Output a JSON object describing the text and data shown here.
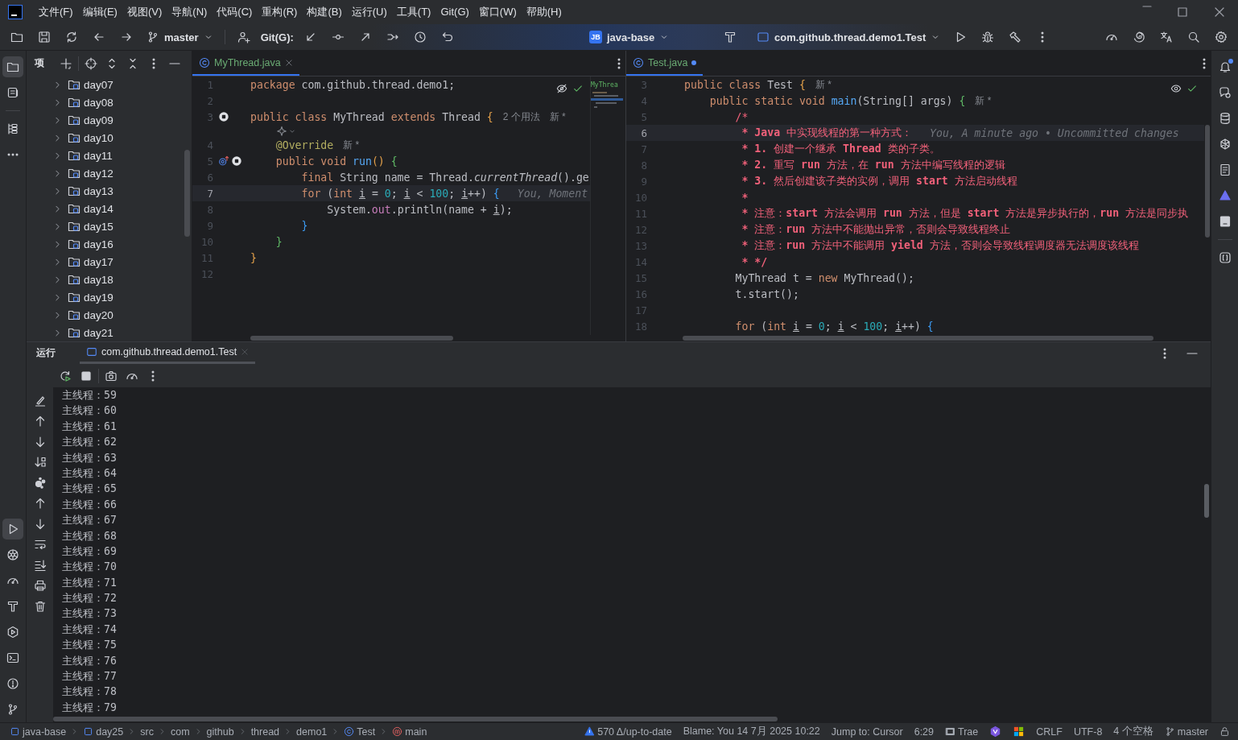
{
  "title_bar": {
    "menus": [
      "文件(F)",
      "编辑(E)",
      "视图(V)",
      "导航(N)",
      "代码(C)",
      "重构(R)",
      "构建(B)",
      "运行(U)",
      "工具(T)",
      "Git(G)",
      "窗口(W)",
      "帮助(H)"
    ]
  },
  "toolbar": {
    "branch": "master",
    "git_label": "Git(G):",
    "project_badge": "JB",
    "project": "java-base",
    "run_config": "com.github.thread.demo1.Test"
  },
  "activity_bar": {
    "top": [
      {
        "kind": "project",
        "selected": true
      },
      {
        "kind": "commit",
        "selected": false
      },
      {
        "kind": "structure",
        "selected": false
      },
      {
        "kind": "more",
        "selected": false
      }
    ],
    "bottom": [
      {
        "kind": "run",
        "selected": true
      },
      {
        "kind": "services",
        "selected": false
      },
      {
        "kind": "profiler",
        "selected": false
      },
      {
        "kind": "build",
        "selected": false
      },
      {
        "kind": "endpoints",
        "selected": false
      },
      {
        "kind": "terminal",
        "selected": false
      },
      {
        "kind": "problems",
        "selected": false
      },
      {
        "kind": "git",
        "selected": false
      }
    ]
  },
  "project_panel": {
    "title": "项",
    "items": [
      {
        "label": "day07",
        "expanded": false
      },
      {
        "label": "day08",
        "expanded": false
      },
      {
        "label": "day09",
        "expanded": false
      },
      {
        "label": "day10",
        "expanded": false
      },
      {
        "label": "day11",
        "expanded": false
      },
      {
        "label": "day12",
        "expanded": false
      },
      {
        "label": "day13",
        "expanded": false
      },
      {
        "label": "day14",
        "expanded": false
      },
      {
        "label": "day15",
        "expanded": false
      },
      {
        "label": "day16",
        "expanded": false
      },
      {
        "label": "day17",
        "expanded": false
      },
      {
        "label": "day18",
        "expanded": false
      },
      {
        "label": "day19",
        "expanded": false
      },
      {
        "label": "day20",
        "expanded": false
      },
      {
        "label": "day21",
        "expanded": false
      }
    ]
  },
  "editors": [
    {
      "tabs": [
        {
          "label": "MyThread.java",
          "selected": true,
          "modified": false
        }
      ],
      "minimap_label": "MyThrea",
      "lines": [
        {
          "kind": "code",
          "number": "1",
          "current": false,
          "t": [
            {
              "kind": "kw",
              "text": "package "
            },
            {
              "kind": "plain",
              "text": "com.github.thread.demo1;"
            }
          ]
        },
        {
          "kind": "code",
          "number": "2",
          "current": false
        },
        {
          "kind": "code",
          "number": "3",
          "current": false,
          "gutter": [
            {
              "kind": "stop"
            }
          ],
          "t": [
            {
              "kind": "kw",
              "text": "public class "
            },
            {
              "kind": "plain",
              "text": "MyThread "
            },
            {
              "kind": "kw",
              "text": "extends "
            },
            {
              "kind": "plain",
              "text": "Thread "
            },
            {
              "kind": "br1",
              "text": "{"
            },
            {
              "kind": "hint",
              "text": "2 个用法"
            },
            {
              "kind": "hint",
              "text": "新 *"
            }
          ]
        },
        {
          "kind": "inlay",
          "current": false
        },
        {
          "kind": "code",
          "number": "4",
          "current": false,
          "t": [
            {
              "kind": "annot",
              "text": "    @Override"
            },
            {
              "kind": "hint",
              "text": "新 *"
            }
          ]
        },
        {
          "kind": "code",
          "number": "5",
          "current": false,
          "gutter": [
            {
              "kind": "override"
            },
            {
              "kind": "stop"
            }
          ],
          "t": [
            {
              "kind": "kw",
              "text": "    public void "
            },
            {
              "kind": "fn",
              "text": "run"
            },
            {
              "kind": "br1",
              "text": "()"
            },
            {
              "kind": "br2",
              "text": " {"
            }
          ]
        },
        {
          "kind": "code",
          "number": "6",
          "current": false,
          "t": [
            {
              "kind": "kw",
              "text": "        final "
            },
            {
              "kind": "plain",
              "text": "String name = Thread."
            },
            {
              "kind": "italic",
              "text": "currentThread"
            },
            {
              "kind": "plain",
              "text": "().ge"
            }
          ]
        },
        {
          "kind": "code",
          "number": "7",
          "current": true,
          "t": [
            {
              "kind": "kw",
              "text": "        for "
            },
            {
              "kind": "plain",
              "text": "("
            },
            {
              "kind": "kw",
              "text": "int "
            },
            {
              "kind": "var",
              "text": "i"
            },
            {
              "kind": "plain",
              "text": " = "
            },
            {
              "kind": "num",
              "text": "0"
            },
            {
              "kind": "plain",
              "text": "; "
            },
            {
              "kind": "var",
              "text": "i"
            },
            {
              "kind": "plain",
              "text": " < "
            },
            {
              "kind": "num",
              "text": "100"
            },
            {
              "kind": "plain",
              "text": "; "
            },
            {
              "kind": "var",
              "text": "i"
            },
            {
              "kind": "plain",
              "text": "++) "
            },
            {
              "kind": "br3",
              "text": "{"
            },
            {
              "kind": "blame",
              "text": "You, Moment"
            }
          ]
        },
        {
          "kind": "code",
          "number": "8",
          "current": false,
          "t": [
            {
              "kind": "plain",
              "text": "            System."
            },
            {
              "kind": "field",
              "text": "out"
            },
            {
              "kind": "plain",
              "text": ".println(name + "
            },
            {
              "kind": "var",
              "text": "i"
            },
            {
              "kind": "plain",
              "text": ");"
            }
          ]
        },
        {
          "kind": "code",
          "number": "9",
          "current": false,
          "t": [
            {
              "kind": "br3",
              "text": "        }"
            }
          ]
        },
        {
          "kind": "code",
          "number": "10",
          "current": false,
          "t": [
            {
              "kind": "br2",
              "text": "    }"
            }
          ]
        },
        {
          "kind": "code",
          "number": "11",
          "current": false,
          "t": [
            {
              "kind": "br1",
              "text": "}"
            }
          ]
        },
        {
          "kind": "code",
          "number": "12",
          "current": false
        }
      ]
    },
    {
      "tabs": [
        {
          "label": "Test.java",
          "selected": true,
          "modified": true
        }
      ],
      "lines": [
        {
          "kind": "code",
          "number": "3",
          "current": false,
          "t": [
            {
              "kind": "kw",
              "text": "public class "
            },
            {
              "kind": "plain",
              "text": "Test "
            },
            {
              "kind": "br1",
              "text": "{"
            },
            {
              "kind": "hint",
              "text": "新 *"
            }
          ]
        },
        {
          "kind": "code",
          "number": "4",
          "current": false,
          "t": [
            {
              "kind": "kw",
              "text": "    public static void "
            },
            {
              "kind": "fn",
              "text": "main"
            },
            {
              "kind": "plain",
              "text": "(String[] args) "
            },
            {
              "kind": "br2",
              "text": "{"
            },
            {
              "kind": "hint",
              "text": "新 *"
            }
          ]
        },
        {
          "kind": "code",
          "number": "5",
          "current": false,
          "t": [
            {
              "kind": "doc",
              "text": "        /*"
            }
          ]
        },
        {
          "kind": "code",
          "number": "6",
          "current": true,
          "t": [
            {
              "kind": "docb",
              "text": "         * Java "
            },
            {
              "kind": "doc",
              "text": "中实现线程的第一种方式："
            },
            {
              "kind": "blame",
              "text": "You, A minute ago • Uncommitted changes"
            }
          ]
        },
        {
          "kind": "code",
          "number": "7",
          "current": false,
          "t": [
            {
              "kind": "docb",
              "text": "         * 1. "
            },
            {
              "kind": "doc",
              "text": "创建一个继承 "
            },
            {
              "kind": "docb",
              "text": "Thread "
            },
            {
              "kind": "doc",
              "text": "类的子类。"
            }
          ]
        },
        {
          "kind": "code",
          "number": "8",
          "current": false,
          "t": [
            {
              "kind": "docb",
              "text": "         * 2. "
            },
            {
              "kind": "doc",
              "text": "重写 "
            },
            {
              "kind": "docb",
              "text": "run "
            },
            {
              "kind": "doc",
              "text": "方法，在 "
            },
            {
              "kind": "docb",
              "text": "run "
            },
            {
              "kind": "doc",
              "text": "方法中编写线程的逻辑"
            }
          ]
        },
        {
          "kind": "code",
          "number": "9",
          "current": false,
          "t": [
            {
              "kind": "docb",
              "text": "         * 3. "
            },
            {
              "kind": "doc",
              "text": "然后创建该子类的实例，调用 "
            },
            {
              "kind": "docb",
              "text": "start "
            },
            {
              "kind": "doc",
              "text": "方法启动线程"
            }
          ]
        },
        {
          "kind": "code",
          "number": "10",
          "current": false,
          "t": [
            {
              "kind": "docb",
              "text": "         *"
            }
          ]
        },
        {
          "kind": "code",
          "number": "11",
          "current": false,
          "t": [
            {
              "kind": "docb",
              "text": "         * "
            },
            {
              "kind": "doc",
              "text": "注意："
            },
            {
              "kind": "docb",
              "text": "start "
            },
            {
              "kind": "doc",
              "text": "方法会调用 "
            },
            {
              "kind": "docb",
              "text": "run "
            },
            {
              "kind": "doc",
              "text": "方法，但是 "
            },
            {
              "kind": "docb",
              "text": "start "
            },
            {
              "kind": "doc",
              "text": "方法是异步执行的，"
            },
            {
              "kind": "docb",
              "text": "run "
            },
            {
              "kind": "doc",
              "text": "方法是同步执"
            }
          ]
        },
        {
          "kind": "code",
          "number": "12",
          "current": false,
          "t": [
            {
              "kind": "docb",
              "text": "         * "
            },
            {
              "kind": "doc",
              "text": "注意："
            },
            {
              "kind": "docb",
              "text": "run "
            },
            {
              "kind": "doc",
              "text": "方法中不能抛出异常，否则会导致线程终止"
            }
          ]
        },
        {
          "kind": "code",
          "number": "13",
          "current": false,
          "t": [
            {
              "kind": "docb",
              "text": "         * "
            },
            {
              "kind": "doc",
              "text": "注意："
            },
            {
              "kind": "docb",
              "text": "run "
            },
            {
              "kind": "doc",
              "text": "方法中不能调用 "
            },
            {
              "kind": "docb",
              "text": "yield "
            },
            {
              "kind": "doc",
              "text": "方法，否则会导致线程调度器无法调度该线程"
            }
          ]
        },
        {
          "kind": "code",
          "number": "14",
          "current": false,
          "t": [
            {
              "kind": "docb",
              "text": "         * */"
            }
          ]
        },
        {
          "kind": "code",
          "number": "15",
          "current": false,
          "t": [
            {
              "kind": "plain",
              "text": "        MyThread t = "
            },
            {
              "kind": "kw",
              "text": "new "
            },
            {
              "kind": "plain",
              "text": "MyThread();"
            }
          ]
        },
        {
          "kind": "code",
          "number": "16",
          "current": false,
          "t": [
            {
              "kind": "plain",
              "text": "        t.start();"
            }
          ]
        },
        {
          "kind": "code",
          "number": "17",
          "current": false
        },
        {
          "kind": "code",
          "number": "18",
          "current": false,
          "t": [
            {
              "kind": "kw",
              "text": "        for "
            },
            {
              "kind": "plain",
              "text": "("
            },
            {
              "kind": "kw",
              "text": "int "
            },
            {
              "kind": "var",
              "text": "i"
            },
            {
              "kind": "plain",
              "text": " = "
            },
            {
              "kind": "num",
              "text": "0"
            },
            {
              "kind": "plain",
              "text": "; "
            },
            {
              "kind": "var",
              "text": "i"
            },
            {
              "kind": "plain",
              "text": " < "
            },
            {
              "kind": "num",
              "text": "100"
            },
            {
              "kind": "plain",
              "text": "; "
            },
            {
              "kind": "var",
              "text": "i"
            },
            {
              "kind": "plain",
              "text": "++) "
            },
            {
              "kind": "br3",
              "text": "{"
            }
          ]
        }
      ]
    }
  ],
  "run_panel": {
    "title": "运行",
    "tabs": [
      {
        "label": "com.github.thread.demo1.Test",
        "selected": true
      }
    ],
    "output": [
      "主线程：59",
      "主线程：60",
      "主线程：61",
      "主线程：62",
      "主线程：63",
      "主线程：64",
      "主线程：65",
      "主线程：66",
      "主线程：67",
      "主线程：68",
      "主线程：69",
      "主线程：70",
      "主线程：71",
      "主线程：72",
      "主线程：73",
      "主线程：74",
      "主线程：75",
      "主线程：76",
      "主线程：77",
      "主线程：78",
      "主线程：79"
    ]
  },
  "status_bar": {
    "breadcrumbs": [
      {
        "label": "java-base",
        "kind": "module"
      },
      {
        "label": "day25",
        "kind": "module"
      },
      {
        "label": "src",
        "kind": "package"
      },
      {
        "label": "com",
        "kind": "package"
      },
      {
        "label": "github",
        "kind": "package"
      },
      {
        "label": "thread",
        "kind": "package"
      },
      {
        "label": "demo1",
        "kind": "package"
      },
      {
        "label": "Test",
        "kind": "class"
      },
      {
        "label": "main",
        "kind": "method"
      }
    ],
    "vcs_changes": "570 Δ/up-to-date",
    "blame": "Blame: You 14 7月 2025 10:22",
    "jump": "Jump to: Cursor",
    "position": "6:29",
    "plugin": "Trae",
    "line_ending": "CRLF",
    "encoding": "UTF-8",
    "indent": "4 个空格",
    "branch": "master"
  }
}
